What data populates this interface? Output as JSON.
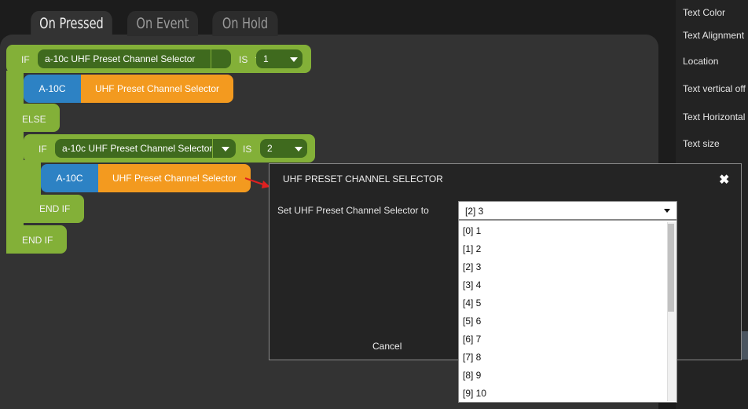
{
  "tabs": [
    "On Pressed",
    "On Event",
    "On Hold"
  ],
  "right_panel": {
    "labels": [
      "Text Color",
      "Text Alignment",
      "Location",
      "Text vertical off",
      "Text Horizontal",
      "Text size"
    ]
  },
  "blocks": {
    "if_kw": "IF",
    "is_kw": "IS",
    "else_kw": "ELSE",
    "end_if_kw": "END IF",
    "outer_condition": "a-10c UHF Preset Channel Selector",
    "outer_value": "1",
    "action1_device": "A-10C",
    "action1_control": "UHF Preset Channel Selector",
    "inner_condition": "a-10c UHF Preset Channel Selector",
    "inner_value": "2",
    "action2_device": "A-10C",
    "action2_control": "UHF Preset Channel Selector"
  },
  "dialog": {
    "title": "UHF PRESET CHANNEL SELECTOR",
    "close_icon": "✖",
    "label": "Set UHF Preset Channel Selector to",
    "selected": "[2] 3",
    "cancel": "Cancel",
    "options": [
      "[0] 1",
      "[1] 2",
      "[2] 3",
      "[3] 4",
      "[4] 5",
      "[5] 6",
      "[6] 7",
      "[7] 8",
      "[8] 9",
      "[9] 10"
    ]
  }
}
